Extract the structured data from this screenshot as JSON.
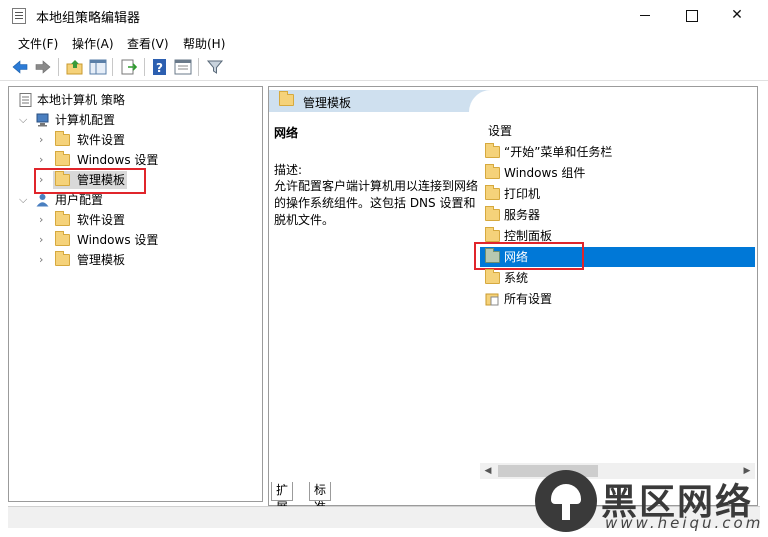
{
  "window": {
    "title": "本地组策略编辑器",
    "controls": {
      "minimize": "minimize-icon",
      "maximize": "maximize-icon",
      "close": "✕"
    }
  },
  "menu": [
    "文件(F)",
    "操作(A)",
    "查看(V)",
    "帮助(H)"
  ],
  "toolbar": [
    "back-arrow-icon",
    "forward-arrow-icon",
    "up-folder-icon",
    "show-hide-tree-icon",
    "export-list-icon",
    "help-icon",
    "properties-icon",
    "filter-icon"
  ],
  "tree": {
    "root": "本地计算机 策略",
    "computer": {
      "label": "计算机配置",
      "children": [
        "软件设置",
        "Windows 设置",
        "管理模板"
      ]
    },
    "user": {
      "label": "用户配置",
      "children": [
        "软件设置",
        "Windows 设置",
        "管理模板"
      ]
    }
  },
  "right": {
    "header": "管理模板",
    "item_title": "网络",
    "desc_label": "描述:",
    "desc_text": "允许配置客户端计算机用以连接到网络的操作系统组件。这包括 DNS 设置和脱机文件。",
    "settings_heading": "设置",
    "list": [
      "“开始”菜单和任务栏",
      "Windows 组件",
      "打印机",
      "服务器",
      "控制面板",
      "网络",
      "系统",
      "所有设置"
    ],
    "selected_index": 5
  },
  "tabs": [
    "扩展",
    "标准"
  ],
  "watermark": {
    "title": "黑区网络",
    "url": "www.heiqu.com"
  },
  "colors": {
    "selection": "#0078d7",
    "highlight_box": "#e0252b",
    "folder": "#f5d27a",
    "header_band": "#cfe0ef"
  }
}
